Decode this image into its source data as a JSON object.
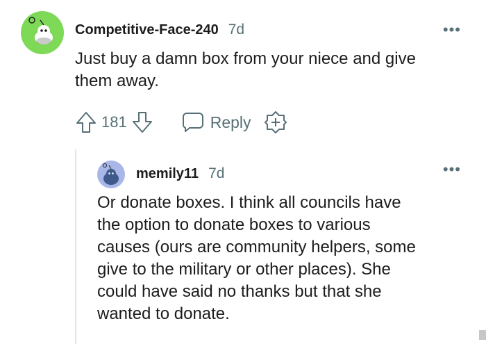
{
  "comments": [
    {
      "username": "Competitive-Face-240",
      "time": "7d",
      "body_lines": [
        "Just buy a damn box from your niece and give",
        "them away."
      ],
      "score": "181",
      "reply_label": "Reply",
      "avatar_color": "#7ed957",
      "icons": [
        "more-icon",
        "upvote-icon",
        "downvote-icon",
        "reply-icon",
        "award-icon"
      ]
    },
    {
      "username": "memily11",
      "time": "7d",
      "body_lines": [
        "Or donate boxes. I think all councils have",
        "the option to donate boxes to various",
        "causes (ours are community helpers, some",
        "give to the military or other places). She",
        "could have said no thanks but that she",
        "wanted to donate."
      ],
      "avatar_color": "#a8b7e8",
      "icons": [
        "more-icon"
      ]
    }
  ],
  "colors": {
    "meta_gray": "#576f76",
    "text": "#1c1c1c",
    "thread_line": "#dde3e6"
  },
  "more_glyph": "•••"
}
